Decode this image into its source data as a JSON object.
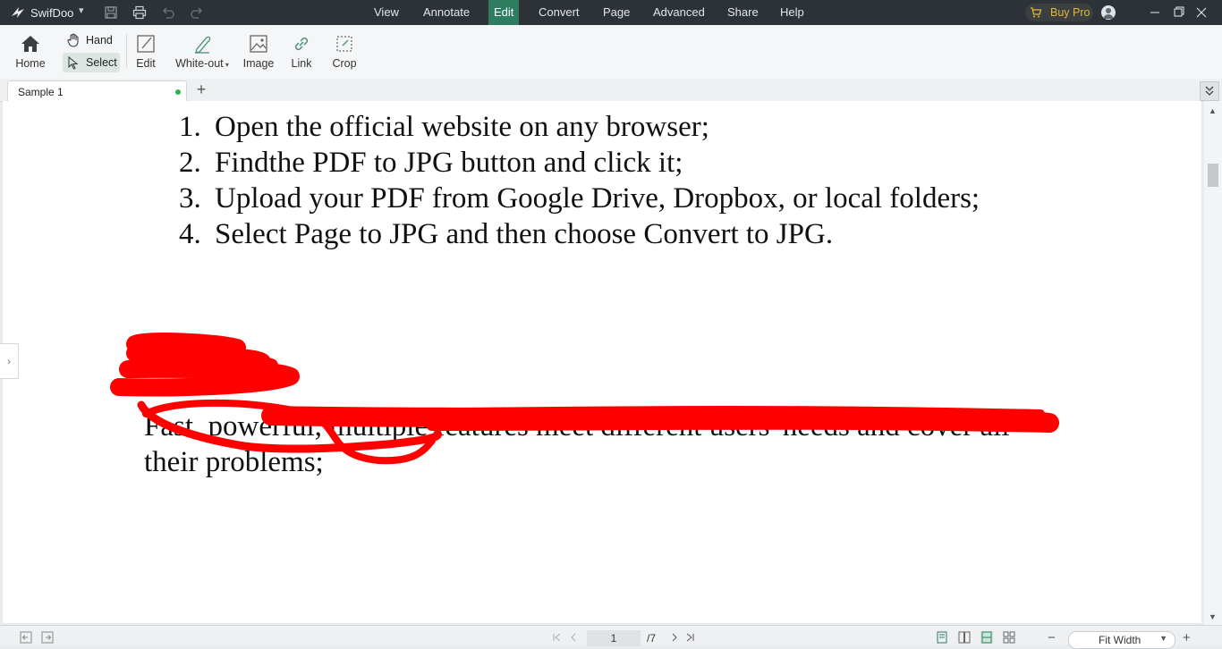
{
  "app": {
    "name": "SwifDoo"
  },
  "menu": {
    "items": [
      {
        "label": "View",
        "active": false
      },
      {
        "label": "Annotate",
        "active": false
      },
      {
        "label": "Edit",
        "active": true
      },
      {
        "label": "Convert",
        "active": false
      },
      {
        "label": "Page",
        "active": false
      },
      {
        "label": "Advanced",
        "active": false
      },
      {
        "label": "Share",
        "active": false
      },
      {
        "label": "Help",
        "active": false
      }
    ],
    "buy_pro": "Buy Pro"
  },
  "toolbar": {
    "home": "Home",
    "hand": "Hand",
    "select": "Select",
    "edit": "Edit",
    "white_out": "White-out",
    "image": "Image",
    "link": "Link",
    "crop": "Crop"
  },
  "tabs": [
    {
      "label": "Sample 1",
      "modified": true
    }
  ],
  "document": {
    "list": [
      {
        "num": "1.",
        "text": "Open the official website on any browser;"
      },
      {
        "num": "2.",
        "text": "Findthe PDF to JPG button and click it;"
      },
      {
        "num": "3.",
        "text": "Upload your PDF from Google Drive, Dropbox, or local folders;"
      },
      {
        "num": "4.",
        "text": "Select Page to JPG and then choose Convert to JPG."
      }
    ],
    "paragraph_line1": "Fast, powerful, multiple features meet different users' needs and cover all",
    "paragraph_line2": "their problems;"
  },
  "status": {
    "current_page": "1",
    "total_pages": "/7",
    "zoom": "Fit Width"
  },
  "colors": {
    "titlebar": "#2c3238",
    "accent": "#2f7d61",
    "buy_pro": "#e3b93a",
    "redaction": "#ff0000"
  }
}
